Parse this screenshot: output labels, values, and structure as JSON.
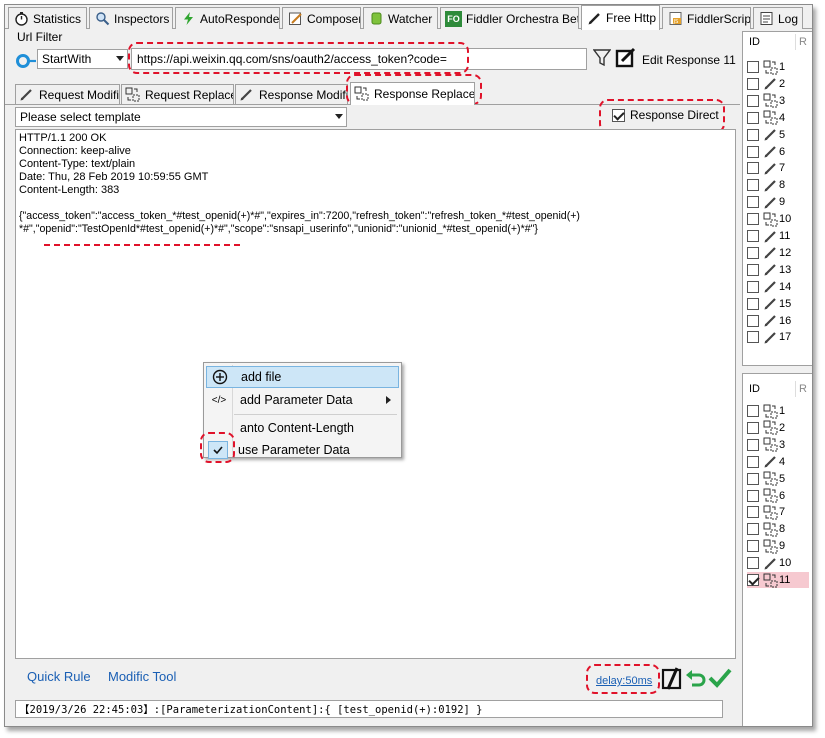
{
  "tabs": [
    {
      "label": "Statistics",
      "icon": "stopwatch-icon"
    },
    {
      "label": "Inspectors",
      "icon": "magnifier-icon"
    },
    {
      "label": "AutoResponder",
      "icon": "lightning-icon"
    },
    {
      "label": "Composer",
      "icon": "compose-icon"
    },
    {
      "label": "Watcher",
      "icon": "watcher-icon"
    },
    {
      "label": "Fiddler Orchestra Beta",
      "icon": "fo-badge-icon",
      "badge": "FO"
    },
    {
      "label": "Free Http",
      "icon": "pen-icon"
    },
    {
      "label": "FiddlerScript",
      "icon": "script-icon",
      "badge": "JS"
    },
    {
      "label": "Log",
      "icon": "log-icon"
    }
  ],
  "url_filter": {
    "label": "Url Filter",
    "match_mode": "StartWith",
    "url": "https://api.weixin.qq.com/sns/oauth2/access_token?code=",
    "edit_label": "Edit Response 11"
  },
  "subtabs": [
    {
      "label": "Request Modific"
    },
    {
      "label": "Request Replace"
    },
    {
      "label": "Response Modific"
    },
    {
      "label": "Response Replace"
    }
  ],
  "template": {
    "placeholder": "Please select template"
  },
  "response_direct": {
    "label": "Response Direct",
    "checked": true
  },
  "editor": {
    "lines": [
      "HTTP/1.1 200 OK",
      "Connection: keep-alive",
      "Content-Type: text/plain",
      "Date: Thu, 28 Feb 2019 10:59:55 GMT",
      "Content-Length: 383",
      "",
      "{\"access_token\":\"access_token_*#test_openid(+)*#\",\"expires_in\":7200,\"refresh_token\":\"refresh_token_*#test_openid(+)",
      "*#\",\"openid\":\"TestOpenId*#test_openid(+)*#\",\"scope\":\"snsapi_userinfo\",\"unionid\":\"unionid_*#test_openid(+)*#\"}"
    ]
  },
  "context_menu": [
    {
      "label": "add file",
      "icon": "plus-circle-icon",
      "highlighted": true
    },
    {
      "label": "add Parameter Data",
      "icon": "code-tag-icon",
      "submenu": true
    },
    {
      "label": "anto Content-Length",
      "icon": ""
    },
    {
      "label": "use Parameter Data",
      "icon": "checkmark-icon",
      "checked": true
    }
  ],
  "right_top": {
    "header": "ID",
    "header2": "R",
    "rows": [
      {
        "id": "1",
        "icon": "replace-icon",
        "checked": false
      },
      {
        "id": "2",
        "icon": "pencil-icon",
        "checked": false
      },
      {
        "id": "3",
        "icon": "replace-icon",
        "checked": false
      },
      {
        "id": "4",
        "icon": "replace-icon",
        "checked": false
      },
      {
        "id": "5",
        "icon": "pencil-icon",
        "checked": false
      },
      {
        "id": "6",
        "icon": "pencil-icon",
        "checked": false
      },
      {
        "id": "7",
        "icon": "pencil-icon",
        "checked": false
      },
      {
        "id": "8",
        "icon": "pencil-icon",
        "checked": false
      },
      {
        "id": "9",
        "icon": "pencil-icon",
        "checked": false
      },
      {
        "id": "10",
        "icon": "replace-icon",
        "checked": false
      },
      {
        "id": "11",
        "icon": "pencil-icon",
        "checked": false
      },
      {
        "id": "12",
        "icon": "pencil-icon",
        "checked": false
      },
      {
        "id": "13",
        "icon": "pencil-icon",
        "checked": false
      },
      {
        "id": "14",
        "icon": "pencil-icon",
        "checked": false
      },
      {
        "id": "15",
        "icon": "pencil-icon",
        "checked": false
      },
      {
        "id": "16",
        "icon": "pencil-icon",
        "checked": false
      },
      {
        "id": "17",
        "icon": "pencil-icon",
        "checked": false
      }
    ]
  },
  "right_bottom": {
    "header": "ID",
    "header2": "R",
    "rows": [
      {
        "id": "1",
        "icon": "replace-icon",
        "checked": false
      },
      {
        "id": "2",
        "icon": "replace-icon",
        "checked": false
      },
      {
        "id": "3",
        "icon": "replace-icon",
        "checked": false
      },
      {
        "id": "4",
        "icon": "pencil-icon",
        "checked": false
      },
      {
        "id": "5",
        "icon": "replace-icon",
        "checked": false
      },
      {
        "id": "6",
        "icon": "replace-icon",
        "checked": false
      },
      {
        "id": "7",
        "icon": "replace-icon",
        "checked": false
      },
      {
        "id": "8",
        "icon": "replace-icon",
        "checked": false
      },
      {
        "id": "9",
        "icon": "replace-icon",
        "checked": false
      },
      {
        "id": "10",
        "icon": "pencil-icon",
        "checked": false
      },
      {
        "id": "11",
        "icon": "replace-icon",
        "checked": true,
        "selected": true
      }
    ]
  },
  "footer": {
    "quick_rule": "Quick Rule",
    "modific_tool": "Modific Tool",
    "delay": "delay:50ms",
    "status": "【2019/3/26 22:45:03】:[ParameterizationContent]:{ [test_openid(+):0192] }"
  },
  "colors": {
    "highlight_red": "#e0122a",
    "link_blue": "#1a5fb4",
    "menu_highlight": "#cde6f7",
    "selected_row": "#f6c9d0"
  }
}
